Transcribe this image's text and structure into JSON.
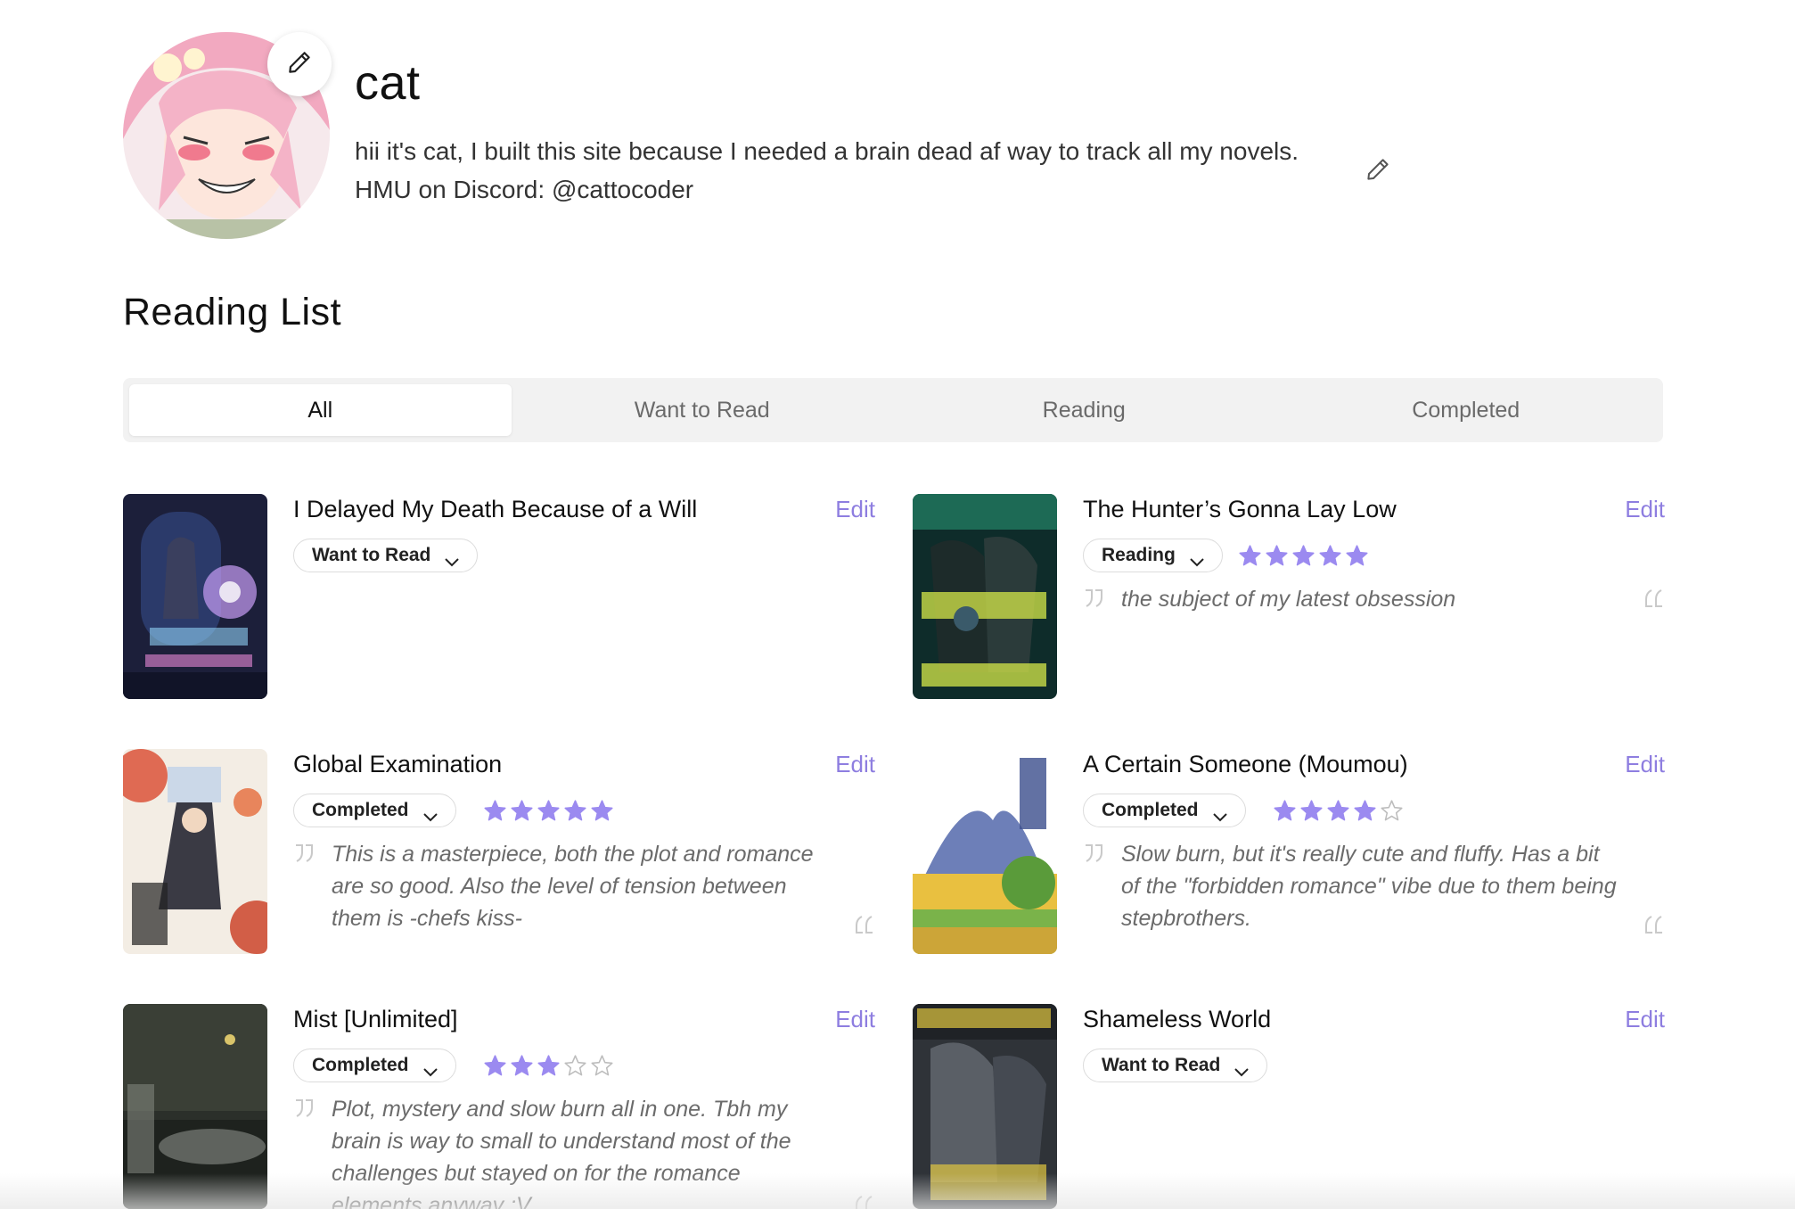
{
  "profile": {
    "username": "cat",
    "bio_line1": "hii it's cat, I built this site because I needed a brain dead af way to track all my novels.",
    "bio_line2": "HMU on Discord: @cattocoder"
  },
  "reading_list": {
    "title": "Reading List",
    "tabs": [
      {
        "label": "All",
        "active": true
      },
      {
        "label": "Want to Read",
        "active": false
      },
      {
        "label": "Reading",
        "active": false
      },
      {
        "label": "Completed",
        "active": false
      }
    ],
    "edit_label": "Edit",
    "books": [
      {
        "title": "I Delayed My Death Because of a Will",
        "status": "Want to Read",
        "rating": null,
        "review": ""
      },
      {
        "title": "The Hunter’s Gonna Lay Low",
        "status": "Reading",
        "rating": 5,
        "review": "the subject of my latest obsession"
      },
      {
        "title": "Global Examination",
        "status": "Completed",
        "rating": 5,
        "review": "This is a masterpiece, both the plot and romance are so good. Also the level of tension between them is -chefs kiss-"
      },
      {
        "title": "A Certain Someone (Moumou)",
        "status": "Completed",
        "rating": 4,
        "review": "Slow burn, but it's really cute and fluffy. Has a bit of the \"forbidden romance\" vibe due to them being stepbrothers."
      },
      {
        "title": "Mist [Unlimited]",
        "status": "Completed",
        "rating": 3,
        "review": "Plot, mystery and slow burn all in one. Tbh my brain is way to small to understand most of the challenges but stayed on for the romance elements anyway :V"
      },
      {
        "title": "Shameless World",
        "status": "Want to Read",
        "rating": null,
        "review": ""
      }
    ]
  },
  "colors": {
    "accent": "#8e7ee0",
    "star_filled": "#9b8af0",
    "tab_bg": "#f2f2f2"
  },
  "icons": {
    "avatar_edit": "pencil-icon",
    "bio_edit": "pencil-icon",
    "status_dropdown": "chevron-down-icon",
    "rating": "star-icon",
    "quote_open": "quote-open-icon",
    "quote_close": "quote-close-icon"
  }
}
